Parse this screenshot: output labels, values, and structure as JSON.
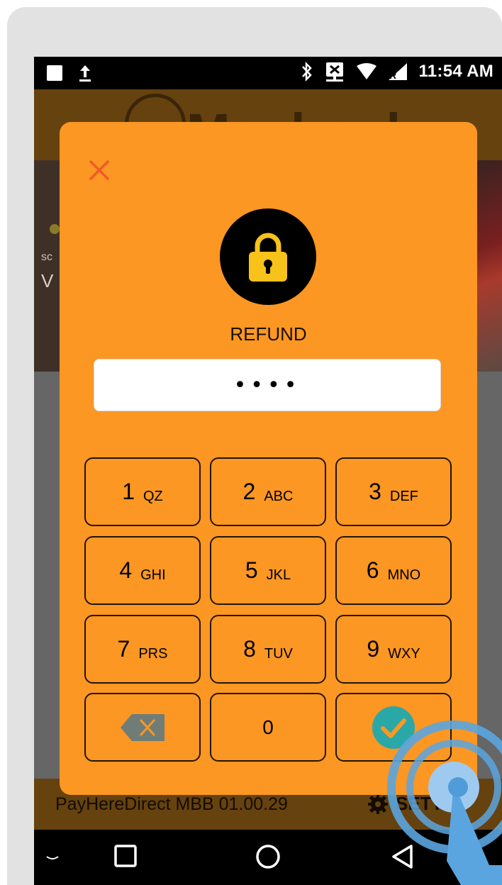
{
  "status_bar": {
    "time": "11:54 AM"
  },
  "background_app": {
    "logo": "Maybank",
    "banner_line1": "sc",
    "banner_line2": "V",
    "footer_version": "PayHereDirect MBB 01.00.29",
    "footer_settings": "SETTI"
  },
  "dialog": {
    "title": "REFUND",
    "pin_value": "••••",
    "keys": [
      {
        "digit": "1",
        "letters": "QZ"
      },
      {
        "digit": "2",
        "letters": "ABC"
      },
      {
        "digit": "3",
        "letters": "DEF"
      },
      {
        "digit": "4",
        "letters": "GHI"
      },
      {
        "digit": "5",
        "letters": "JKL"
      },
      {
        "digit": "6",
        "letters": "MNO"
      },
      {
        "digit": "7",
        "letters": "PRS"
      },
      {
        "digit": "8",
        "letters": "TUV"
      },
      {
        "digit": "9",
        "letters": "WXY"
      }
    ],
    "zero_key": "0"
  },
  "colors": {
    "dialog_bg": "#fb9722",
    "close_icon": "#f05a28",
    "lock_icon": "#f7c21a",
    "confirm_icon": "#2aa8a8",
    "backspace_icon": "#6f7d76",
    "app_brand_dim": "#66420f"
  },
  "icons": {
    "close": "close-icon",
    "lock": "lock-icon",
    "backspace": "backspace-icon",
    "confirm": "check-circle-icon",
    "settings": "gear-icon"
  }
}
